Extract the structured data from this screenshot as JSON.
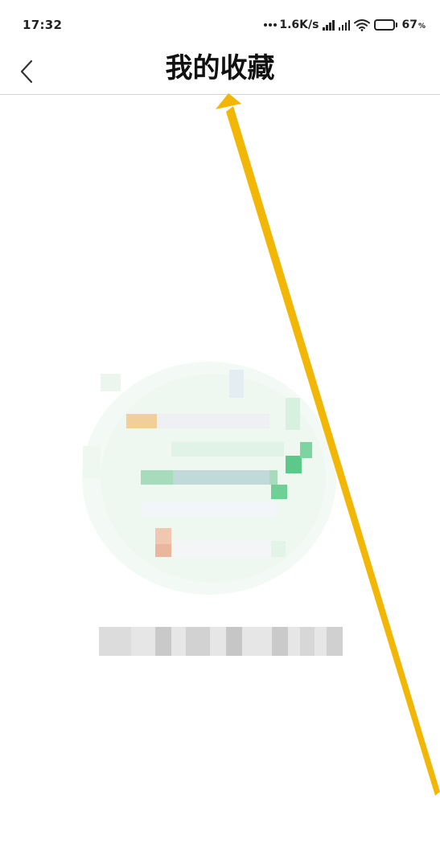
{
  "status_bar": {
    "time": "17:32",
    "net_speed": "1.6K/s",
    "battery_percent": "67",
    "battery_unit": "%",
    "battery_level": 0.67,
    "icons": [
      "dots-icon",
      "signal-icon",
      "signal-icon",
      "wifi-icon",
      "battery-icon"
    ]
  },
  "nav": {
    "back_icon": "chevron-left-icon",
    "title": "我的收藏"
  },
  "colors": {
    "annotation_arrow": "#F2B705",
    "illustration_green": "#5cc98a",
    "illustration_orange": "#f3c27a"
  }
}
